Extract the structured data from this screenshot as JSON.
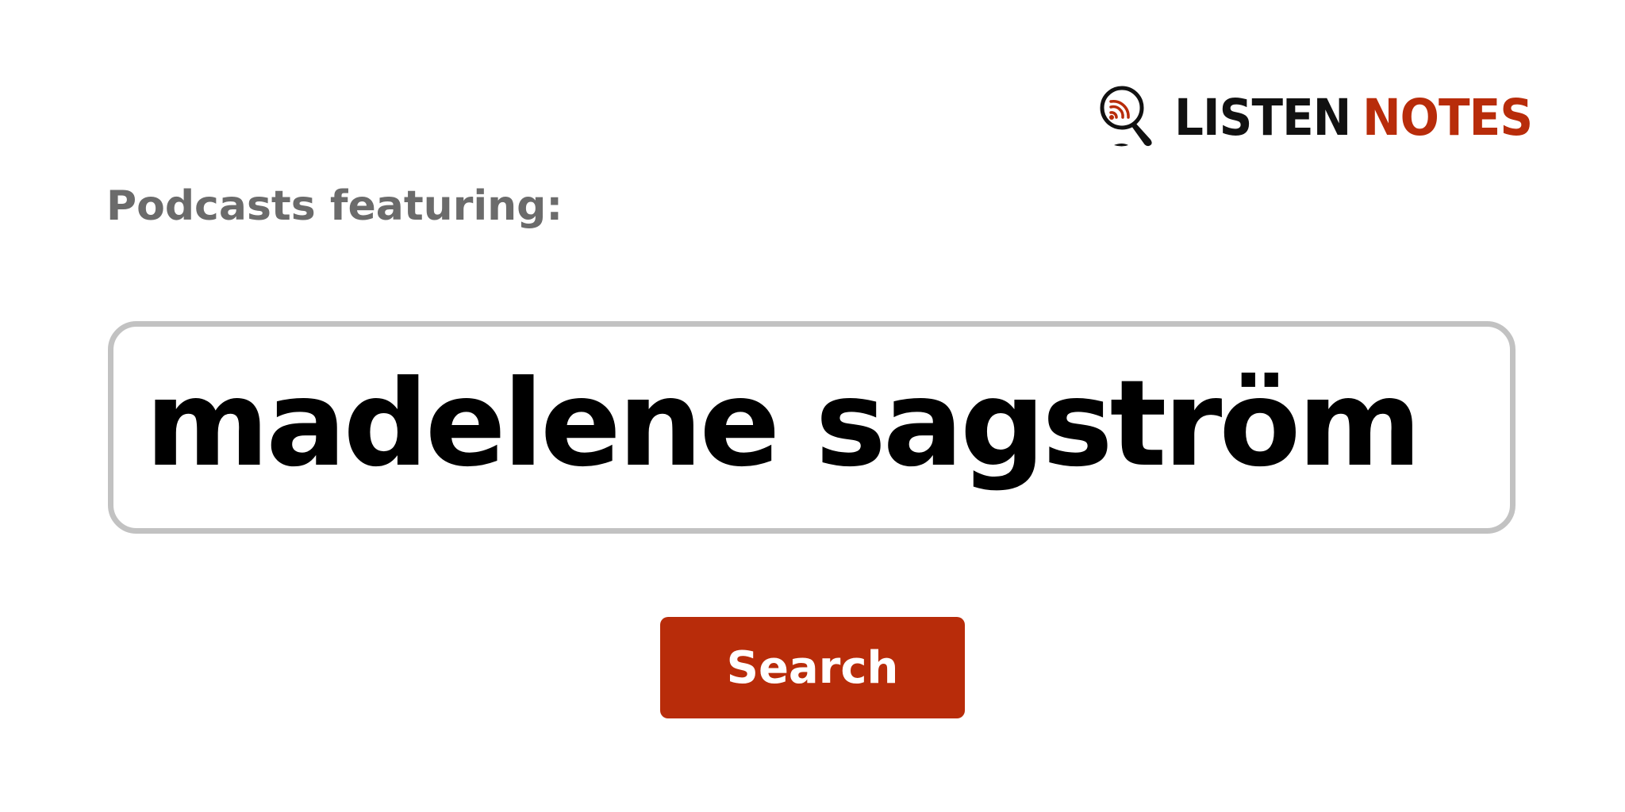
{
  "brand": {
    "logo_icon": "podcast-magnifier-icon",
    "name_part_1": "LISTEN",
    "name_part_2": "NOTES",
    "colors": {
      "dark": "#111111",
      "accent": "#b82c0a"
    }
  },
  "heading": "Podcasts featuring:",
  "search": {
    "value": "madelene sagström",
    "border_color": "#c2c2c2"
  },
  "search_button": {
    "label": "Search",
    "color": "#b82c0a"
  }
}
